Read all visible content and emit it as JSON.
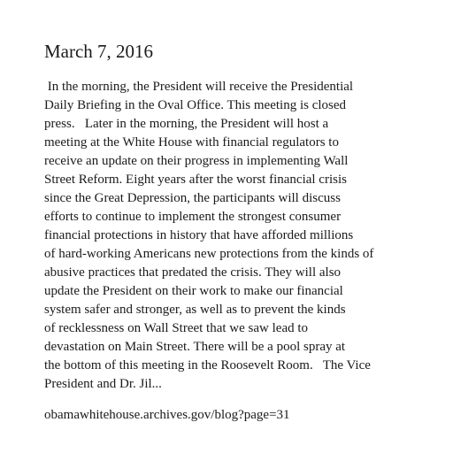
{
  "post": {
    "date": "March 7, 2016",
    "lines": [
      " In the morning, the President will receive the Presidential",
      "Daily Briefing in the Oval Office. This meeting is closed",
      "press.   Later in the morning, the President will host a",
      "meeting at the White House with financial regulators to",
      "receive an update on their progress in implementing Wall",
      "Street Reform. Eight years after the worst financial crisis",
      "since the Great Depression, the participants will discuss",
      "efforts to continue to implement the strongest consumer",
      "financial protections in history that have afforded millions",
      "of hard-working Americans new protections from the kinds of",
      "abusive practices that predated the crisis. They will also",
      "update the President on their work to make our financial",
      "system safer and stronger, as well as to prevent the kinds",
      "of recklessness on Wall Street that we saw lead to",
      "devastation on Main Street. There will be a pool spray at",
      "the bottom of this meeting in the Roosevelt Room.   The Vice",
      "President and Dr. Jil..."
    ],
    "source_url": "obamawhitehouse.archives.gov/blog?page=31"
  }
}
